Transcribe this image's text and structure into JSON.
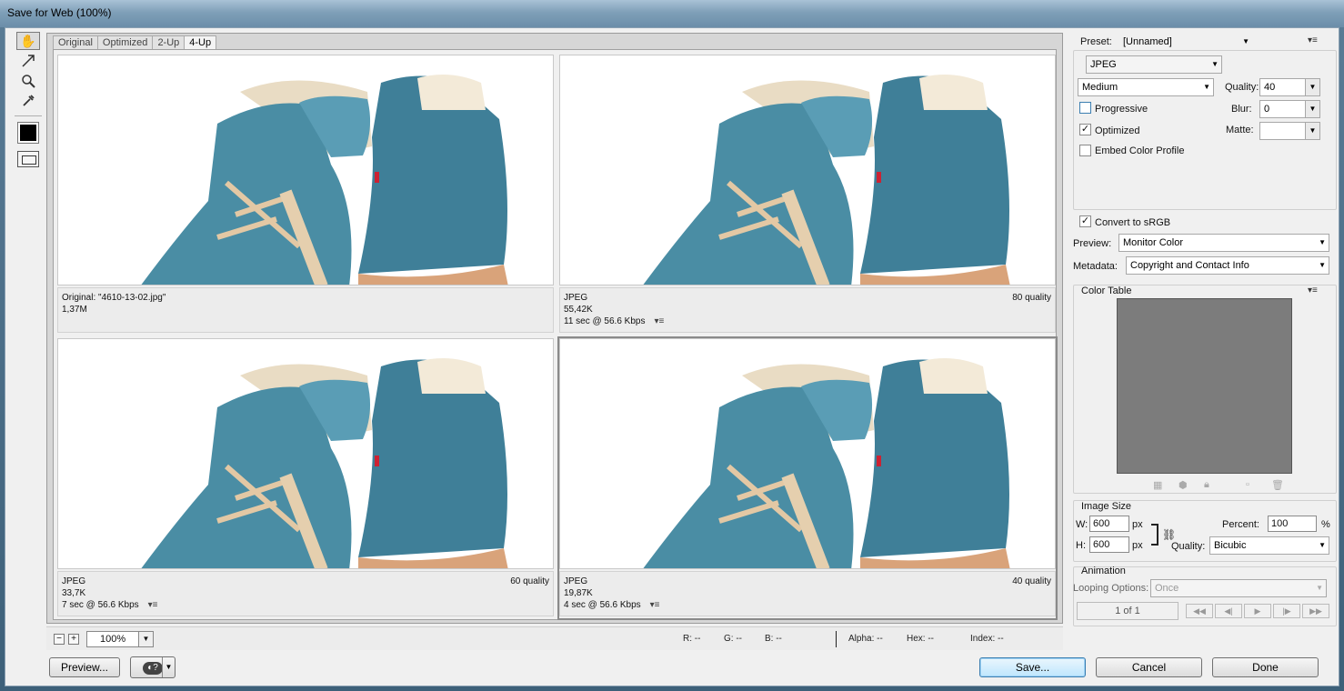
{
  "window": {
    "title": "Save for Web (100%)"
  },
  "tabs": [
    "Original",
    "Optimized",
    "2-Up",
    "4-Up"
  ],
  "panes": [
    {
      "line1": "Original: \"4610-13-02.jpg\"",
      "line2": "1,37M",
      "line3": "",
      "quality": ""
    },
    {
      "line1": "JPEG",
      "line2": "55,42K",
      "line3": "11 sec @ 56.6 Kbps",
      "quality": "80 quality"
    },
    {
      "line1": "JPEG",
      "line2": "33,7K",
      "line3": "7 sec @ 56.6 Kbps",
      "quality": "60 quality"
    },
    {
      "line1": "JPEG",
      "line2": "19,87K",
      "line3": "4 sec @ 56.6 Kbps",
      "quality": "40 quality"
    }
  ],
  "status": {
    "zoom": "100%",
    "r": "R: --",
    "g": "G: --",
    "b": "B: --",
    "alpha": "Alpha: --",
    "hex": "Hex: --",
    "index": "Index: --"
  },
  "buttons": {
    "preview": "Preview...",
    "save": "Save...",
    "cancel": "Cancel",
    "done": "Done"
  },
  "settings": {
    "preset_label": "Preset:",
    "preset_value": "[Unnamed]",
    "format": "JPEG",
    "quality_level": "Medium",
    "quality_label": "Quality:",
    "quality_value": "40",
    "progressive_label": "Progressive",
    "progressive_checked": false,
    "blur_label": "Blur:",
    "blur_value": "0",
    "optimized_label": "Optimized",
    "optimized_checked": true,
    "matte_label": "Matte:",
    "matte_value": "",
    "embed_label": "Embed Color Profile",
    "embed_checked": false,
    "srgb_label": "Convert to sRGB",
    "srgb_checked": true,
    "preview_label": "Preview:",
    "preview_value": "Monitor Color",
    "metadata_label": "Metadata:",
    "metadata_value": "Copyright and Contact Info"
  },
  "color_table": {
    "title": "Color Table",
    "color": "#7c7c7c"
  },
  "image_size": {
    "title": "Image Size",
    "w_label": "W:",
    "w_value": "600",
    "w_unit": "px",
    "h_label": "H:",
    "h_value": "600",
    "h_unit": "px",
    "percent_label": "Percent:",
    "percent_value": "100",
    "percent_unit": "%",
    "quality_label": "Quality:",
    "quality_value": "Bicubic"
  },
  "animation": {
    "title": "Animation",
    "looping_label": "Looping Options:",
    "looping_value": "Once",
    "frame_counter": "1 of 1"
  }
}
